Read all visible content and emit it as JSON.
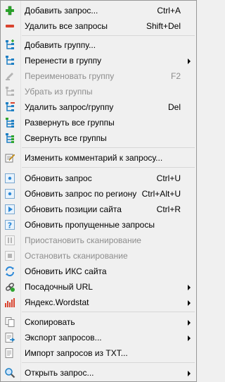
{
  "menu": {
    "items": [
      {
        "label": "Добавить запрос...",
        "shortcut": "Ctrl+A",
        "icon": "plus-icon"
      },
      {
        "label": "Удалить все запросы",
        "shortcut": "Shift+Del",
        "icon": "minus-icon"
      },
      {
        "label": "Добавить группу...",
        "shortcut": "",
        "icon": "add-group-icon"
      },
      {
        "label": "Перенести в группу",
        "shortcut": "",
        "icon": "move-group-icon",
        "submenu": true
      },
      {
        "label": "Переименовать группу",
        "shortcut": "F2",
        "icon": "rename-icon",
        "disabled": true
      },
      {
        "label": "Убрать из группы",
        "shortcut": "",
        "icon": "ungroup-icon",
        "disabled": true
      },
      {
        "label": "Удалить запрос/группу",
        "shortcut": "Del",
        "icon": "delete-group-icon"
      },
      {
        "label": "Развернуть все группы",
        "shortcut": "",
        "icon": "expand-icon"
      },
      {
        "label": "Свернуть все группы",
        "shortcut": "",
        "icon": "collapse-icon"
      },
      {
        "label": "Изменить комментарий к запросу...",
        "shortcut": "",
        "icon": "edit-comment-icon"
      },
      {
        "label": "Обновить запрос",
        "shortcut": "Ctrl+U",
        "icon": "refresh-query-icon"
      },
      {
        "label": "Обновить запрос по региону",
        "shortcut": "Ctrl+Alt+U",
        "icon": "refresh-region-icon"
      },
      {
        "label": "Обновить позиции сайта",
        "shortcut": "Ctrl+R",
        "icon": "play-icon"
      },
      {
        "label": "Обновить пропущенные запросы",
        "shortcut": "",
        "icon": "question-icon"
      },
      {
        "label": "Приостановить сканирование",
        "shortcut": "",
        "icon": "pause-icon",
        "disabled": true
      },
      {
        "label": "Остановить сканирование",
        "shortcut": "",
        "icon": "stop-icon",
        "disabled": true
      },
      {
        "label": "Обновить ИКС сайта",
        "shortcut": "",
        "icon": "sync-icon"
      },
      {
        "label": "Посадочный URL",
        "shortcut": "",
        "icon": "url-icon",
        "submenu": true
      },
      {
        "label": "Яндекс.Wordstat",
        "shortcut": "",
        "icon": "wordstat-icon",
        "submenu": true
      },
      {
        "label": "Скопировать",
        "shortcut": "",
        "icon": "copy-icon",
        "submenu": true
      },
      {
        "label": "Экспорт запросов...",
        "shortcut": "",
        "icon": "export-icon",
        "submenu": true
      },
      {
        "label": "Импорт запросов из TXT...",
        "shortcut": "",
        "icon": "import-icon"
      },
      {
        "label": "Открыть запрос...",
        "shortcut": "",
        "icon": "search-icon",
        "submenu": true
      }
    ]
  },
  "colors": {
    "add": "#2ea52e",
    "remove": "#d9442f",
    "group": "#1e7fc4",
    "gray": "#a0a0a0"
  }
}
